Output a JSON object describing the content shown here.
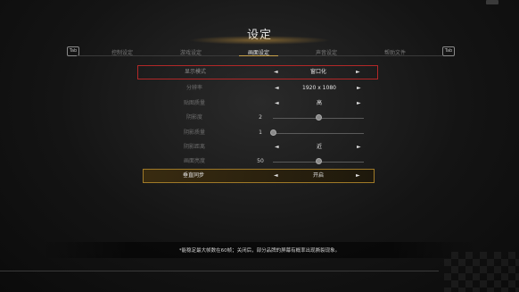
{
  "title": "设定",
  "tabs": {
    "left_key": "Tab",
    "right_key": "Tab",
    "items": [
      {
        "label": "控制设定"
      },
      {
        "label": "游戏设定"
      },
      {
        "label": "画面设定"
      },
      {
        "label": "声音设定"
      },
      {
        "label": "帮助文件"
      }
    ],
    "active": "画面设定"
  },
  "settings": [
    {
      "label": "显示模式",
      "type": "select",
      "value": "窗口化"
    },
    {
      "label": "分辨率",
      "type": "select",
      "value": "1920 x 1080"
    },
    {
      "label": "贴图质量",
      "type": "select",
      "value": "高"
    },
    {
      "label": "阴影度",
      "type": "slider",
      "value": "2",
      "fraction": 0.5
    },
    {
      "label": "阴影质量",
      "type": "slider",
      "value": "1",
      "fraction": 0.0
    },
    {
      "label": "阴影距离",
      "type": "select",
      "value": "近"
    },
    {
      "label": "画面亮度",
      "type": "slider",
      "value": "50",
      "fraction": 0.5
    },
    {
      "label": "垂直同步",
      "type": "select",
      "value": "开启"
    }
  ],
  "arrows": {
    "left": "◄",
    "right": "►"
  },
  "footer": "*能稳定最大帧数在60帧；关闭后，部分品牌的屏幕有概率出现撕裂现象。",
  "colors": {
    "accent": "#c9a24a",
    "highlight_red": "#b22828"
  }
}
